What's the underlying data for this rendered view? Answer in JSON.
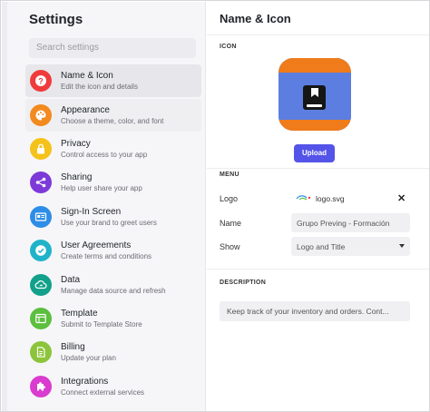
{
  "sidebar": {
    "title": "Settings",
    "search_placeholder": "Search settings",
    "items": [
      {
        "label": "Name & Icon",
        "sub": "Edit the icon and details",
        "icon": "question-icon",
        "color": "#ef3b3b"
      },
      {
        "label": "Appearance",
        "sub": "Choose a theme, color, and font",
        "icon": "palette-icon",
        "color": "#f28a1e"
      },
      {
        "label": "Privacy",
        "sub": "Control access to your app",
        "icon": "lock-icon",
        "color": "#f4c21b"
      },
      {
        "label": "Sharing",
        "sub": "Help user share your app",
        "icon": "share-icon",
        "color": "#7d3ad8"
      },
      {
        "label": "Sign-In Screen",
        "sub": "Use your brand to greet users",
        "icon": "signin-card-icon",
        "color": "#2e8de6"
      },
      {
        "label": "User Agreements",
        "sub": "Create terms and conditions",
        "icon": "check-circle-icon",
        "color": "#1fb3c9"
      },
      {
        "label": "Data",
        "sub": "Manage data source and refresh",
        "icon": "data-cloud-icon",
        "color": "#12a08a"
      },
      {
        "label": "Template",
        "sub": "Submit to Template Store",
        "icon": "template-icon",
        "color": "#5cbf3f"
      },
      {
        "label": "Billing",
        "sub": "Update your plan",
        "icon": "billing-doc-icon",
        "color": "#8cc43b"
      },
      {
        "label": "Integrations",
        "sub": "Connect external services",
        "icon": "puzzle-icon",
        "color": "#d93ccf"
      }
    ]
  },
  "panel": {
    "title": "Name & Icon",
    "icon_section": "ICON",
    "upload_label": "Upload",
    "menu_section": "MENU",
    "logo_label": "Logo",
    "logo_file": "logo.svg",
    "close_glyph": "✕",
    "name_label": "Name",
    "name_value": "Grupo Preving - Formación",
    "show_label": "Show",
    "show_value": "Logo and Title",
    "description_section": "DESCRIPTION",
    "description_value": "Keep track of your inventory and orders. Cont..."
  },
  "colors": {
    "accent": "#5454e8",
    "icon_orange": "#ef7b1a",
    "icon_blue": "#5b7ee0"
  }
}
